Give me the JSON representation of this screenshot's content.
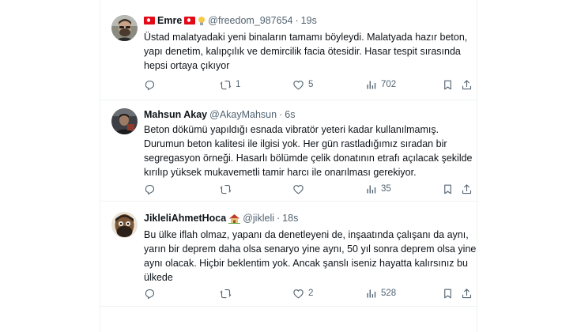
{
  "tweets": [
    {
      "name": "Emre",
      "handle": "@freedom_987654",
      "dot": "·",
      "time": "19s",
      "lines": [
        "Üstad malatyadaki yeni binaların tamamı böyleydi. Malatyada hazır beton,",
        "yapı denetim, kalıpçılık ve demircilik facia ötesidir. Hasar tespit sırasında",
        "hepsi ortaya çıkıyor"
      ],
      "reply_count": "",
      "retweet_count": "1",
      "like_count": "5",
      "view_count": "702"
    },
    {
      "name": "Mahsun Akay",
      "handle": "@AkayMahsun",
      "dot": "·",
      "time": "6s",
      "lines": [
        "Beton dökümü yapıldığı esnada vibratör yeteri kadar kullanılmamış.",
        "Durumun beton kalitesi ile ilgisi yok. Her gün rastladığımız sıradan bir",
        "segregasyon örneği. Hasarlı bölümde çelik donatının etrafı açılacak şekilde",
        "kırılıp yüksek mukavemetli tamir harcı ile onarılması gerekiyor."
      ],
      "reply_count": "",
      "retweet_count": "",
      "like_count": "",
      "view_count": "35"
    },
    {
      "name": "JikleliAhmetHoca",
      "handle": "@jikleli",
      "dot": "·",
      "time": "18s",
      "lines": [
        "Bu ülke iflah olmaz, yapanı da denetleyeni de, inşaatında çalışanı da aynı,",
        "yarın bir deprem daha olsa senaryo yine aynı, 50 yıl sonra deprem olsa yine",
        "aynı olacak. Hiçbir beklentim yok. Ancak şanslı iseniz hayatta kalırsınız bu",
        "ülkede"
      ],
      "reply_count": "",
      "retweet_count": "",
      "like_count": "2",
      "view_count": "528"
    }
  ],
  "icons": [
    "reply-icon",
    "retweet-icon",
    "like-icon",
    "views-icon",
    "bookmark-icon",
    "share-icon"
  ],
  "colors": {
    "text": "#0f1419",
    "secondary": "#536471",
    "divider": "#eff3f4",
    "flag_red": "#e30a17"
  }
}
